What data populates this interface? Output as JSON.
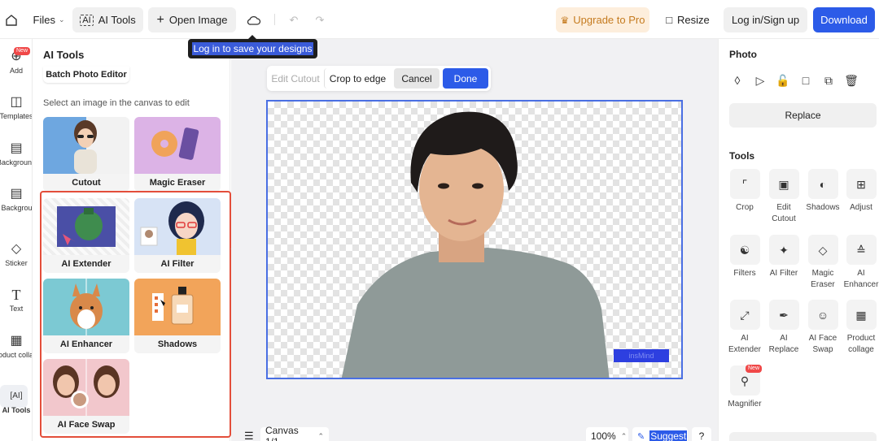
{
  "topbar": {
    "files_label": "Files",
    "ai_tools_label": "AI Tools",
    "open_image_label": "Open Image",
    "upgrade_label": "Upgrade to Pro",
    "resize_label": "Resize",
    "login_label": "Log in/Sign up",
    "download_label": "Download",
    "tooltip": "Log in to save your designs"
  },
  "rail": {
    "items": [
      {
        "label": "Add",
        "icon": "plus-circle-icon",
        "badge": "New"
      },
      {
        "label": "Templates",
        "icon": "template-icon"
      },
      {
        "label": "Background",
        "icon": "background-icon"
      },
      {
        "label": "AI Background",
        "icon": "ai-background-icon"
      },
      {
        "label": "Sticker",
        "icon": "sticker-icon"
      },
      {
        "label": "Text",
        "icon": "text-icon"
      },
      {
        "label": "Product collage",
        "icon": "collage-icon"
      },
      {
        "label": "AI Tools",
        "icon": "ai-tools-icon"
      }
    ]
  },
  "panel": {
    "title": "AI Tools",
    "batch_label": "Batch Photo Editor",
    "hint": "Select an image in the canvas to edit",
    "cards": [
      {
        "label": "Cutout"
      },
      {
        "label": "Magic Eraser"
      },
      {
        "label": "AI Extender"
      },
      {
        "label": "AI Filter"
      },
      {
        "label": "AI Enhancer"
      },
      {
        "label": "Shadows"
      },
      {
        "label": "AI Face Swap"
      }
    ]
  },
  "canvas": {
    "edit_cutout": "Edit Cutout",
    "crop_to_edge": "Crop to edge",
    "cancel": "Cancel",
    "done": "Done",
    "watermark": "insMind",
    "canvas_label": "Canvas 1/1",
    "zoom": "100%",
    "suggest": "Suggest",
    "help": "?"
  },
  "right": {
    "photo_title": "Photo",
    "replace_label": "Replace",
    "tools_title": "Tools",
    "tools": [
      {
        "label": "Crop",
        "icon": "crop-icon"
      },
      {
        "label": "Edit Cutout",
        "icon": "edit-cutout-icon"
      },
      {
        "label": "Shadows",
        "icon": "shadows-icon"
      },
      {
        "label": "Adjust",
        "icon": "adjust-icon"
      },
      {
        "label": "Filters",
        "icon": "filters-icon"
      },
      {
        "label": "AI Filter",
        "icon": "ai-filter-icon"
      },
      {
        "label": "Magic Eraser",
        "icon": "eraser-icon"
      },
      {
        "label": "AI Enhancer",
        "icon": "enhancer-icon"
      },
      {
        "label": "AI Extender",
        "icon": "extender-icon"
      },
      {
        "label": "AI Replace",
        "icon": "replace-brush-icon"
      },
      {
        "label": "AI Face Swap",
        "icon": "face-swap-icon"
      },
      {
        "label": "Product collage",
        "icon": "collage-icon"
      },
      {
        "label": "Magnifier",
        "icon": "magnifier-icon",
        "badge": "New"
      }
    ]
  },
  "colors": {
    "accent": "#2c5be8",
    "upgrade_bg": "#fdeedc",
    "upgrade_text": "#c57b1f",
    "highlight_border": "#e34e3a"
  }
}
